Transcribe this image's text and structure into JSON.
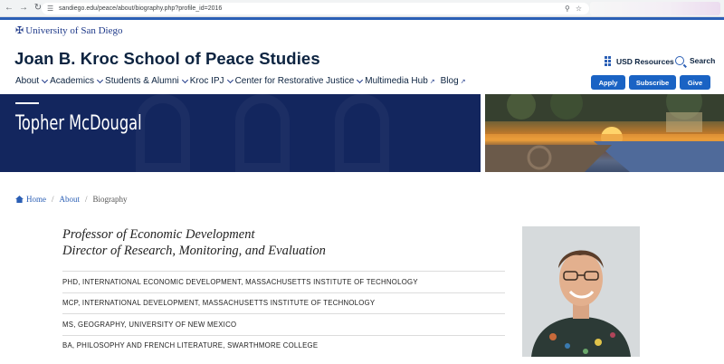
{
  "browser": {
    "url": "sandiego.edu/peace/about/biography.php?profile_id=2016"
  },
  "header": {
    "logo_text": "University of San Diego",
    "site_title": "Joan B. Kroc School of Peace Studies",
    "utility": [
      {
        "label": "USD Resources",
        "icon": "grid-icon"
      },
      {
        "label": "Search",
        "icon": "search-icon"
      }
    ]
  },
  "nav": {
    "items": [
      {
        "label": "About",
        "type": "dropdown"
      },
      {
        "label": "Academics",
        "type": "dropdown"
      },
      {
        "label": "Students & Alumni",
        "type": "dropdown"
      },
      {
        "label": "Kroc IPJ",
        "type": "dropdown"
      },
      {
        "label": "Center for Restorative Justice",
        "type": "dropdown"
      },
      {
        "label": "Multimedia Hub",
        "type": "external"
      },
      {
        "label": "Blog",
        "type": "external"
      }
    ],
    "cta": [
      {
        "label": "Apply"
      },
      {
        "label": "Subscribe"
      },
      {
        "label": "Give"
      }
    ]
  },
  "banner": {
    "name": "Topher McDougal"
  },
  "breadcrumb": [
    {
      "label": "Home",
      "link": true
    },
    {
      "label": "About",
      "link": true
    },
    {
      "label": "Biography",
      "link": false
    }
  ],
  "profile": {
    "roles": [
      "Professor of Economic Development",
      "Director of Research, Monitoring, and Evaluation"
    ],
    "degrees": [
      "PHD, INTERNATIONAL ECONOMIC DEVELOPMENT, MASSACHUSETTS INSTITUTE OF TECHNOLOGY",
      "MCP, INTERNATIONAL DEVELOPMENT, MASSACHUSETTS INSTITUTE OF TECHNOLOGY",
      "MS, GEOGRAPHY, UNIVERSITY OF NEW MEXICO",
      "BA, PHILOSOPHY AND FRENCH LITERATURE, SWARTHMORE COLLEGE"
    ]
  },
  "colors": {
    "brand_navy": "#0c2340",
    "banner_navy": "#13265e",
    "cta_blue": "#1a63c4",
    "link_blue": "#2b5fb5"
  }
}
